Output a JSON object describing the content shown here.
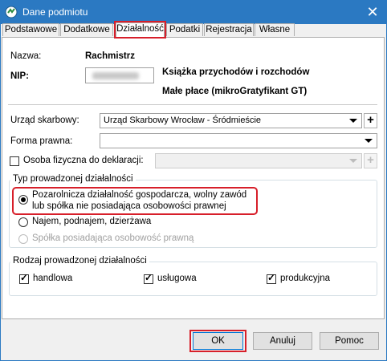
{
  "window": {
    "title": "Dane podmiotu",
    "close": "✕"
  },
  "tabs": [
    "Podstawowe",
    "Dodatkowe",
    "Działalność",
    "Podatki",
    "Rejestracja",
    "Własne"
  ],
  "active_tab": "Działalność",
  "form": {
    "name_label": "Nazwa:",
    "name_value": "Rachmistrz",
    "nip_label": "NIP:",
    "book_type": "Książka przychodów i rozchodów",
    "size_type": "Małe płace (mikroGratyfikant GT)",
    "tax_office_label": "Urząd skarbowy:",
    "tax_office_value": "Urząd Skarbowy Wrocław - Śródmieście",
    "legal_form_label": "Forma prawna:",
    "legal_form_value": "",
    "person_label": "Osoba fizyczna do deklaracji:",
    "person_value": "",
    "plus": "+"
  },
  "activity_type": {
    "title": "Typ prowadzonej działalności",
    "options": [
      {
        "label_line1": "Pozarolnicza działalność gospodarcza, wolny zawód",
        "label_line2": "lub spółka nie posiadająca osobowości prawnej",
        "selected": true,
        "disabled": false
      },
      {
        "label": "Najem, podnajem, dzierżawa",
        "selected": false,
        "disabled": false
      },
      {
        "label": "Spółka posiadająca osobowość prawną",
        "selected": false,
        "disabled": true
      }
    ]
  },
  "activity_kind": {
    "title": "Rodzaj prowadzonej działalności",
    "options": [
      {
        "label": "handlowa",
        "checked": true
      },
      {
        "label": "usługowa",
        "checked": true
      },
      {
        "label": "produkcyjna",
        "checked": true
      }
    ]
  },
  "buttons": {
    "ok": "OK",
    "cancel": "Anuluj",
    "help": "Pomoc"
  },
  "colors": {
    "titlebar": "#2b79c2",
    "highlight": "#d71f2a"
  }
}
